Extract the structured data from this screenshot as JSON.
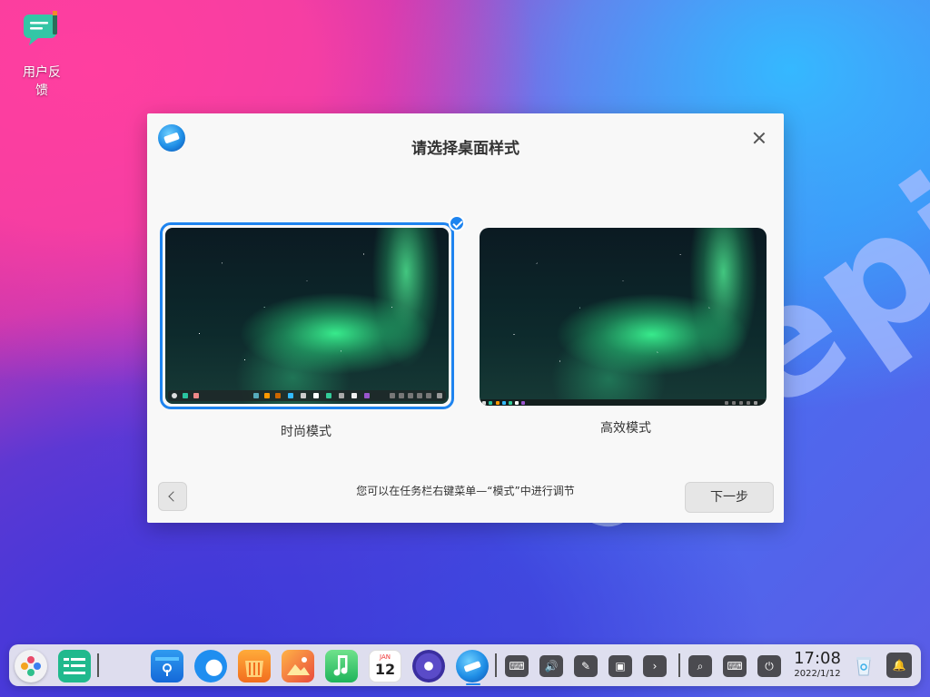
{
  "desktop": {
    "watermark": "deepin",
    "icons": [
      {
        "label": "用户反\n馈",
        "icon": "feedback-icon"
      }
    ]
  },
  "dialog": {
    "title": "请选择桌面样式",
    "options": [
      {
        "label": "时尚模式",
        "selected": true
      },
      {
        "label": "高效模式",
        "selected": false
      }
    ],
    "hint": "您可以在任务栏右键菜单—“模式”中进行调节",
    "next_label": "下一步",
    "colors": {
      "accent": "#1e84ef",
      "background": "#f8f8f8"
    }
  },
  "taskbar": {
    "apps": [
      "launcher-icon",
      "multitasking-view-icon",
      "app-store-icon",
      "browser-icon",
      "deepin-store-icon",
      "image-viewer-icon",
      "music-icon",
      "calendar-icon",
      "control-center-icon",
      "welcome-icon"
    ],
    "calendar": {
      "month": "JAN",
      "day": "12"
    },
    "tray": [
      "onboard-keyboard-icon",
      "volume-icon",
      "brightness-icon",
      "display-icon",
      "expand-icon"
    ],
    "quick": [
      "search-icon",
      "keyboard-layout-icon",
      "power-icon"
    ],
    "time": "17:08",
    "date": "2022/1/12",
    "right": [
      "trash-icon",
      "notification-bell-icon"
    ]
  }
}
